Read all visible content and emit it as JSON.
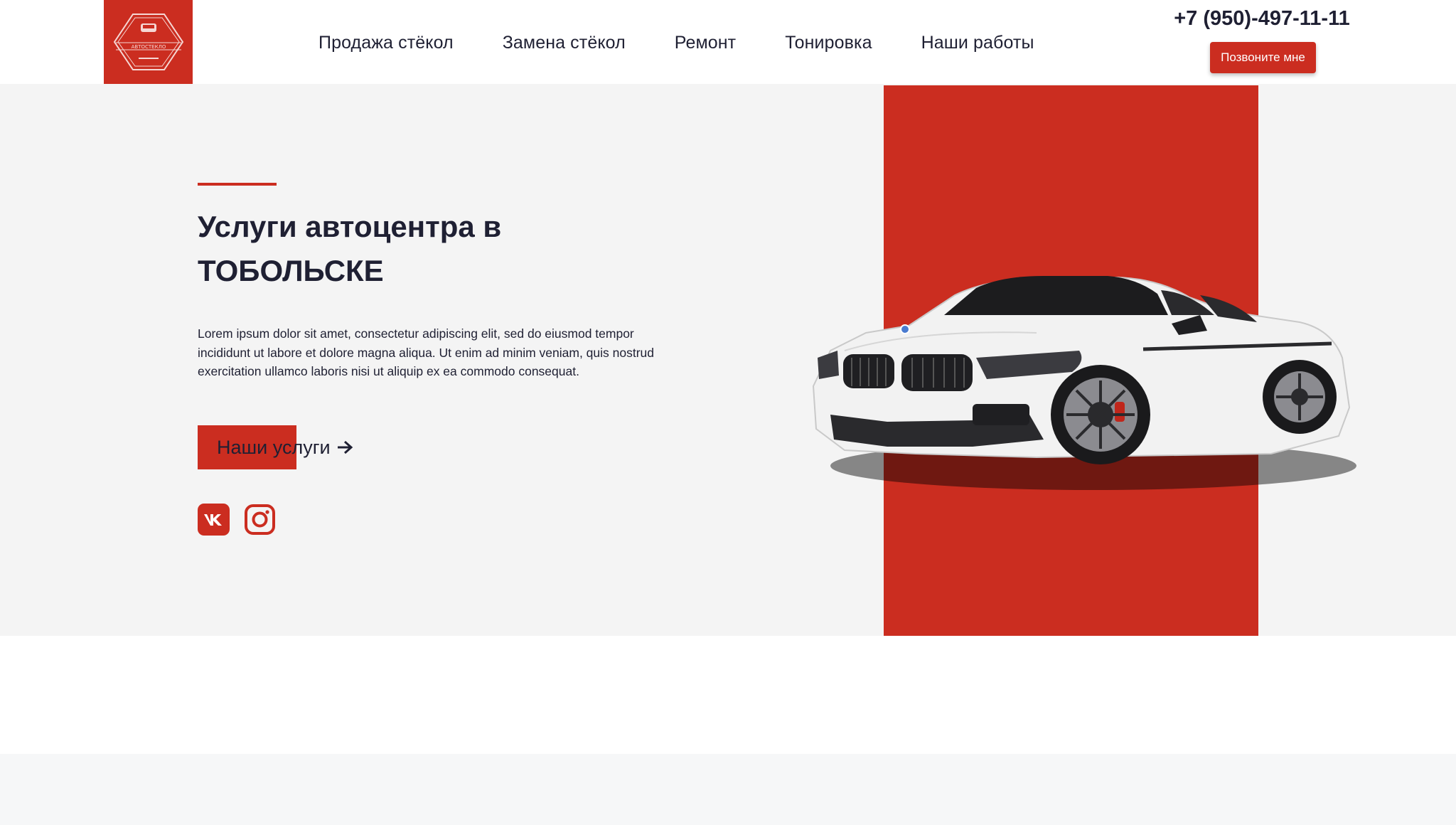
{
  "header": {
    "logo_text": "АВТОСТЕКЛО",
    "nav": [
      {
        "label": "Продажа стёкол"
      },
      {
        "label": "Замена стёкол"
      },
      {
        "label": "Ремонт"
      },
      {
        "label": "Тонировка"
      },
      {
        "label": "Наши работы"
      }
    ],
    "phone": "+7 (950)-497-11-11",
    "call_button": "Позвоните мне"
  },
  "hero": {
    "title_line1": "Услуги автоцентра в",
    "title_line2": "ТОБОЛЬСКЕ",
    "text": "Lorem ipsum dolor sit amet, consectetur adipiscing elit, sed do eiusmod tempor incididunt ut labore et dolore magna aliqua. Ut enim ad minim veniam, quis nostrud exercitation ullamco laboris nisi ut aliquip ex ea commodo consequat.",
    "button_label": "Наши услуги",
    "social": [
      {
        "icon": "vk-icon"
      },
      {
        "icon": "instagram-icon"
      }
    ]
  },
  "colors": {
    "accent": "#cb2d20",
    "text": "#1f2033",
    "hero_bg": "#f4f4f4"
  }
}
